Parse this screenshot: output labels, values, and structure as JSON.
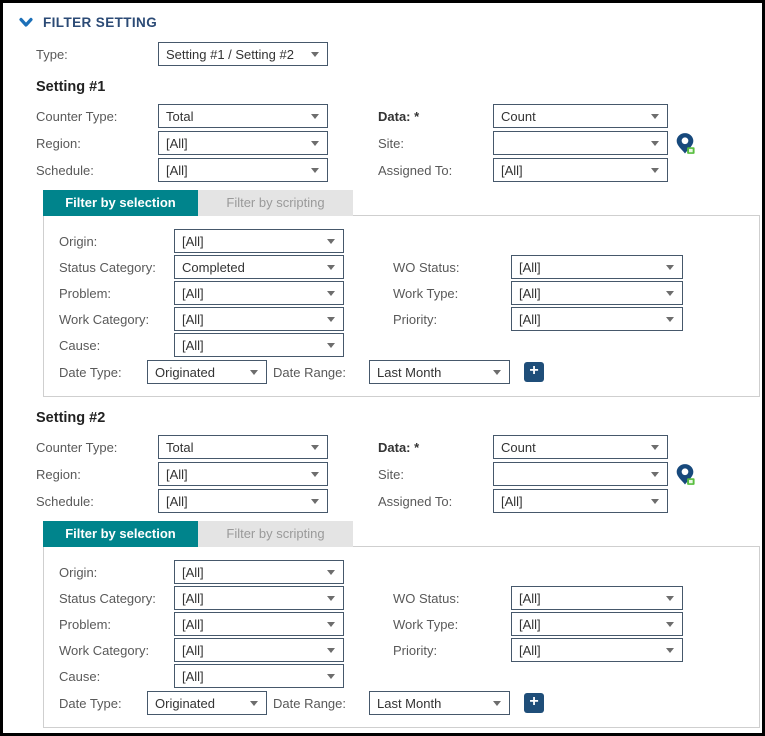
{
  "header": {
    "title": "FILTER SETTING"
  },
  "type_row": {
    "label": "Type:",
    "value": "Setting #1 / Setting #2"
  },
  "tabs": {
    "selection": "Filter by selection",
    "scripting": "Filter by scripting"
  },
  "labels": {
    "counter_type": "Counter Type:",
    "region": "Region:",
    "schedule": "Schedule:",
    "data": "Data: *",
    "site": "Site:",
    "assigned_to": "Assigned To:",
    "origin": "Origin:",
    "status_category": "Status Category:",
    "problem": "Problem:",
    "work_category": "Work Category:",
    "cause": "Cause:",
    "date_type": "Date Type:",
    "date_range": "Date Range:",
    "wo_status": "WO Status:",
    "work_type": "Work Type:",
    "priority": "Priority:"
  },
  "settings": [
    {
      "heading": "Setting #1",
      "values": {
        "counter_type": "Total",
        "region": "[All]",
        "schedule": "[All]",
        "data": "Count",
        "site": "",
        "assigned_to": "[All]",
        "origin": "[All]",
        "status_category": "Completed",
        "problem": "[All]",
        "work_category": "[All]",
        "cause": "[All]",
        "wo_status": "[All]",
        "work_type": "[All]",
        "priority": "[All]",
        "date_type": "Originated",
        "date_range": "Last Month"
      }
    },
    {
      "heading": "Setting #2",
      "values": {
        "counter_type": "Total",
        "region": "[All]",
        "schedule": "[All]",
        "data": "Count",
        "site": "",
        "assigned_to": "[All]",
        "origin": "[All]",
        "status_category": "[All]",
        "problem": "[All]",
        "work_category": "[All]",
        "cause": "[All]",
        "wo_status": "[All]",
        "work_type": "[All]",
        "priority": "[All]",
        "date_type": "Originated",
        "date_range": "Last Month"
      }
    }
  ],
  "colors": {
    "accent_teal": "#00848c",
    "header_blue": "#2b4a75",
    "chevron_blue": "#1c70b8",
    "control_border": "#46586b",
    "add_button_blue": "#1f4e79",
    "pin_blue": "#17497c",
    "pin_badge_green": "#58be3f"
  }
}
